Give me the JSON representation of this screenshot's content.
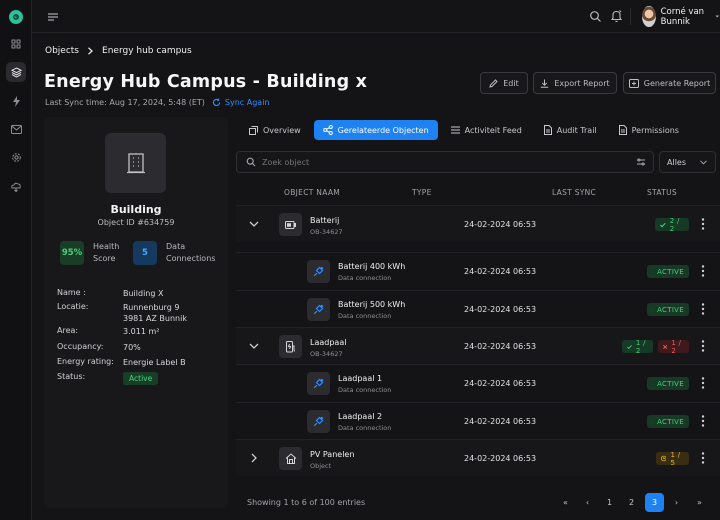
{
  "nav": {
    "items": [
      "dashboard-icon",
      "layers-icon",
      "bolt-icon",
      "mail-icon",
      "gear-icon",
      "cloud-icon"
    ],
    "active_index": 1
  },
  "topbar": {
    "user_name": "Corné van Bunnik"
  },
  "breadcrumb": {
    "root": "Objects",
    "current": "Energy hub campus"
  },
  "header": {
    "title": "Energy Hub Campus - Building x",
    "last_sync": "Last Sync time: Aug 17, 2024, 5:48 (ET)",
    "sync_again": "Sync Again",
    "buttons": {
      "edit": "Edit",
      "export": "Export Report",
      "generate": "Generate Report"
    }
  },
  "building": {
    "name": "Building",
    "object_id": "Object ID #634759",
    "health_value": "95%",
    "health_label_1": "Health",
    "health_label_2": "Score",
    "connections_value": "5",
    "connections_label_1": "Data",
    "connections_label_2": "Connections",
    "details": [
      {
        "key": "Name :",
        "value": "Building X"
      },
      {
        "key": "Locatie:",
        "value": "Runnenburg 9",
        "value2": "3981 AZ Bunnik"
      },
      {
        "key": "Area:",
        "value": "3.011 m²"
      },
      {
        "key": "Occupancy:",
        "value": "70%"
      },
      {
        "key": "Energy rating:",
        "value": "Energie Label B"
      },
      {
        "key": "Status:",
        "value": "Active"
      }
    ]
  },
  "tabs": [
    {
      "label": "Overview",
      "icon": "overview-icon"
    },
    {
      "label": "Gerelateerde Objecten",
      "icon": "link-icon",
      "active": true
    },
    {
      "label": "Activiteit Feed",
      "icon": "list-icon"
    },
    {
      "label": "Audit Trail",
      "icon": "document-icon"
    },
    {
      "label": "Permissions",
      "icon": "document-icon"
    }
  ],
  "search": {
    "placeholder": "Zoek object",
    "filter_value": "Alles"
  },
  "table": {
    "columns": {
      "name": "OBJECT NAAM",
      "type": "TYPE",
      "last_sync": "LAST SYNC",
      "status": "STATUS"
    },
    "rows": [
      {
        "level": "parent",
        "expanded": true,
        "icon": "battery-icon",
        "title": "Batterij",
        "sub": "OB-34627",
        "date": "24-02-2024 06:53",
        "status": [
          {
            "kind": "ok",
            "text": "2 / 2"
          }
        ]
      },
      {
        "level": "child",
        "icon": "plug-icon",
        "title": "Batterij 400 kWh",
        "sub": "Data connection",
        "date": "24-02-2024 06:53",
        "status": [
          {
            "kind": "ok",
            "text": "ACTIVE"
          }
        ]
      },
      {
        "level": "child",
        "icon": "plug-icon",
        "title": "Batterij 500 kWh",
        "sub": "Data connection",
        "date": "24-02-2024 06:53",
        "status": [
          {
            "kind": "ok",
            "text": "ACTIVE"
          }
        ]
      },
      {
        "level": "parent",
        "expanded": true,
        "icon": "charger-icon",
        "title": "Laadpaal",
        "sub": "OB-34627",
        "date": "24-02-2024 06:53",
        "status": [
          {
            "kind": "ok",
            "text": "1 / 2"
          },
          {
            "kind": "err",
            "text": "1 / 2"
          }
        ]
      },
      {
        "level": "child",
        "icon": "plug-icon",
        "title": "Laadpaal 1",
        "sub": "Data connection",
        "date": "24-02-2024 06:53",
        "status": [
          {
            "kind": "ok",
            "text": "ACTIVE"
          }
        ]
      },
      {
        "level": "child",
        "icon": "plug-icon",
        "title": "Laadpaal 2",
        "sub": "Data connection",
        "date": "24-02-2024 06:53",
        "status": [
          {
            "kind": "ok",
            "text": "ACTIVE"
          }
        ]
      },
      {
        "level": "parent",
        "expanded": false,
        "icon": "solar-home-icon",
        "title": "PV Panelen",
        "sub": "Object",
        "date": "24-02-2024 06:53",
        "status": [
          {
            "kind": "warn",
            "text": "1 / 5"
          }
        ]
      }
    ]
  },
  "footer": {
    "showing": "Showing 1 to 6 of 100 entries",
    "pages": [
      "«",
      "‹",
      "1",
      "2",
      "3",
      "›",
      "»"
    ],
    "active_page": "3"
  },
  "colors": {
    "accent": "#1f82f2",
    "success": "#48cf77",
    "danger": "#f05a5f",
    "warning": "#e7b43a",
    "brand": "#2bc29a"
  }
}
